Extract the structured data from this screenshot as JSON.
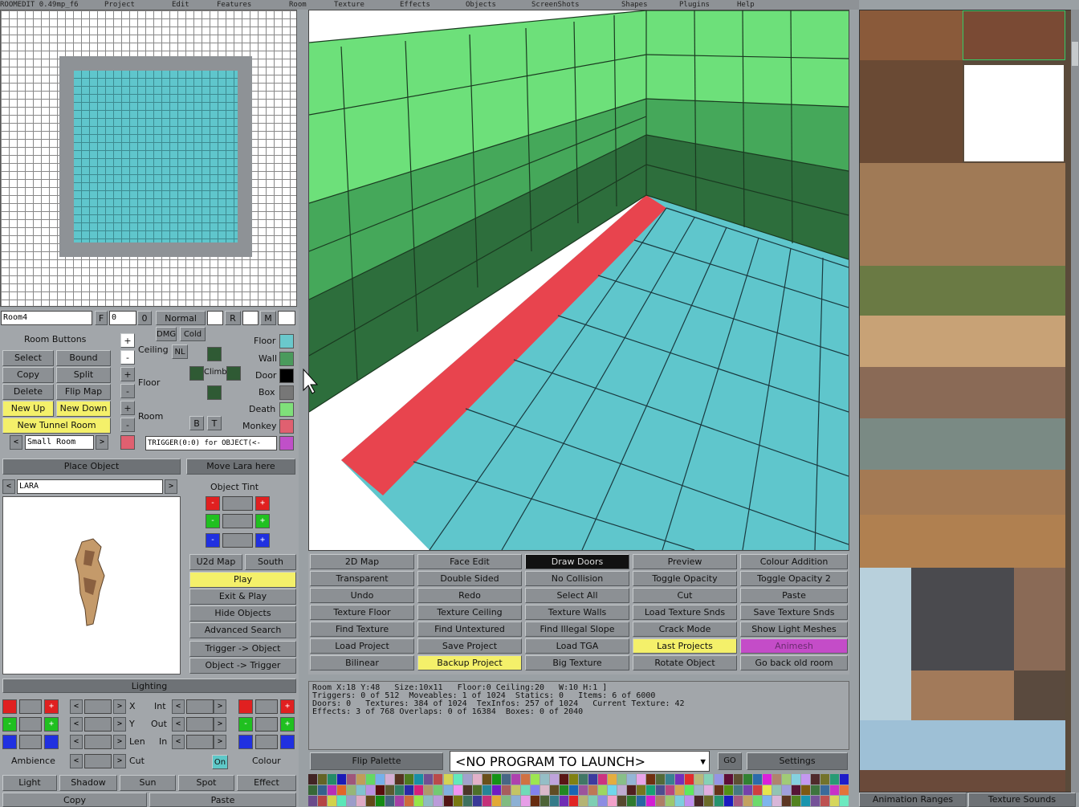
{
  "menu": [
    "ROOMEDIT 0.49mp_f6",
    "Project",
    "Edit",
    "Features",
    "Room",
    "Texture",
    "Effects",
    "Objects",
    "ScreenShots",
    "Shapes",
    "Plugins",
    "Help"
  ],
  "room_panel": {
    "room_name": "Room4",
    "f_label": "F",
    "f_value": "0",
    "o_value": "0",
    "normal_label": "Normal",
    "r_label": "R",
    "m_label": "M",
    "room_buttons_title": "Room Buttons",
    "select": "Select",
    "bound": "Bound",
    "copy": "Copy",
    "split": "Split",
    "delete": "Delete",
    "flip_map": "Flip Map",
    "new_up": "New Up",
    "new_down": "New Down",
    "new_tunnel_room": "New Tunnel Room",
    "room_size": "Small Room",
    "plus": "+",
    "minus": "-",
    "dmg": "DMG",
    "cold": "Cold",
    "ceiling": "Ceiling",
    "nl": "NL",
    "climb": "Climb",
    "floor": "Floor",
    "room": "Room",
    "b": "B",
    "t": "T",
    "legend": [
      "Floor",
      "Wall",
      "Door",
      "Box",
      "Death",
      "Monkey"
    ],
    "legend_colors": [
      "#6ac8cc",
      "#4a9a5c",
      "#000000",
      "#777777",
      "#7fe07a",
      "#e06070",
      "#c050c8"
    ],
    "trigger_text": "TRIGGER(0:0) for OBJECT(<-"
  },
  "object_panel": {
    "place_object": "Place Object",
    "move_lara": "Move Lara here",
    "object_name": "LARA",
    "object_tint": "Object Tint",
    "left_arrow": "<",
    "right_arrow": ">"
  },
  "nav": {
    "u2d_map": "U2d Map",
    "south": "South",
    "play": "Play",
    "exit_play": "Exit & Play",
    "hide_objects": "Hide Objects",
    "advanced_search": "Advanced Search",
    "trigger_object": "Trigger -> Object",
    "object_trigger": "Object -> Trigger"
  },
  "lighting": {
    "title": "Lighting",
    "x": "X",
    "y": "Y",
    "len": "Len",
    "cut": "Cut",
    "int": "Int",
    "out": "Out",
    "in": "In",
    "on": "On",
    "ambience": "Ambience",
    "colour": "Colour",
    "light": "Light",
    "shadow": "Shadow",
    "sun": "Sun",
    "spot": "Spot",
    "effect": "Effect",
    "copy": "Copy",
    "paste": "Paste"
  },
  "toolbar": [
    [
      "2D Map",
      "Face Edit",
      "Draw Doors",
      "Preview",
      "Colour Addition"
    ],
    [
      "Transparent",
      "Double Sided",
      "No Collision",
      "Toggle Opacity",
      "Toggle Opacity 2"
    ],
    [
      "Undo",
      "Redo",
      "Select All",
      "Cut",
      "Paste"
    ],
    [
      "Texture Floor",
      "Texture Ceiling",
      "Texture Walls",
      "Load Texture Snds",
      "Save Texture Snds"
    ],
    [
      "Find Texture",
      "Find Untextured",
      "Find Illegal Slope",
      "Crack Mode",
      "Show Light Meshes"
    ],
    [
      "Load Project",
      "Save Project",
      "Load TGA",
      "Last Projects",
      "Animesh"
    ],
    [
      "Bilinear",
      "Backup Project",
      "Big Texture",
      "Rotate Object",
      "Go back old room"
    ]
  ],
  "info": [
    "Room X:18 Y:48   Size:10x11   Floor:0 Ceiling:20   W:10 H:1 ]",
    "Triggers: 0 of 512  Moveables: 1 of 1024  Statics: 0   Items: 6 of 6000",
    "Doors: 0   Textures: 384 of 1024  TexInfos: 257 of 1024   Current Texture: 42",
    "Effects: 3 of 768 Overlaps: 0 of 16384  Boxes: 0 of 2040"
  ],
  "bottom": {
    "flip_palette": "Flip Palette",
    "launch": "<NO PROGRAM TO LAUNCH>",
    "go": "GO",
    "settings": "Settings",
    "animation_ranges": "Animation Ranges",
    "texture_sounds": "Texture Sounds"
  }
}
